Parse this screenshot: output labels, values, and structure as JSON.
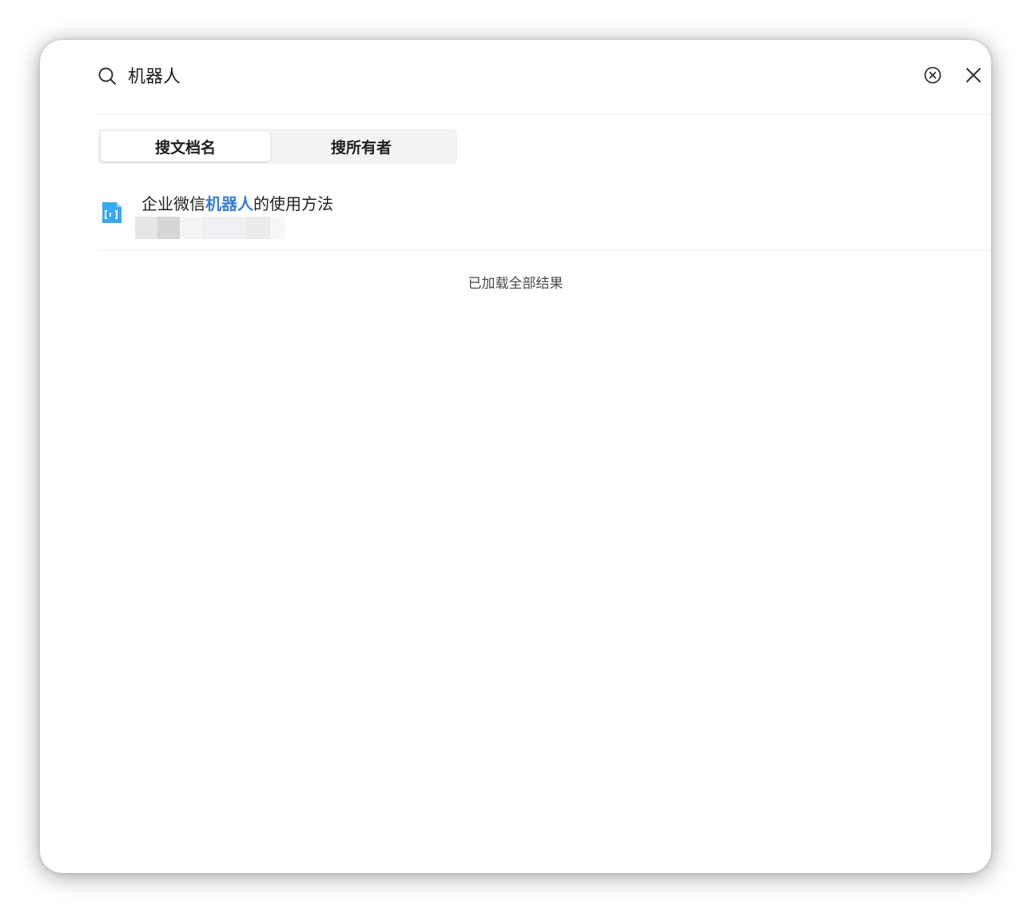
{
  "search": {
    "value": "机器人",
    "icon": "search-icon"
  },
  "actions": {
    "clear_icon": "clear-circle-icon",
    "close_icon": "close-icon"
  },
  "tabs": [
    {
      "label": "搜文档名",
      "active": true
    },
    {
      "label": "搜所有者",
      "active": false
    }
  ],
  "results": [
    {
      "title_prefix": "企业微信",
      "title_highlight": "机器人",
      "title_suffix": "的使用方法",
      "icon": "document-icon",
      "icon_color": "#3aa8f2"
    }
  ],
  "footer": {
    "status": "已加载全部结果"
  },
  "colors": {
    "highlight": "#3a7fd0",
    "text": "#1f1f1f"
  }
}
